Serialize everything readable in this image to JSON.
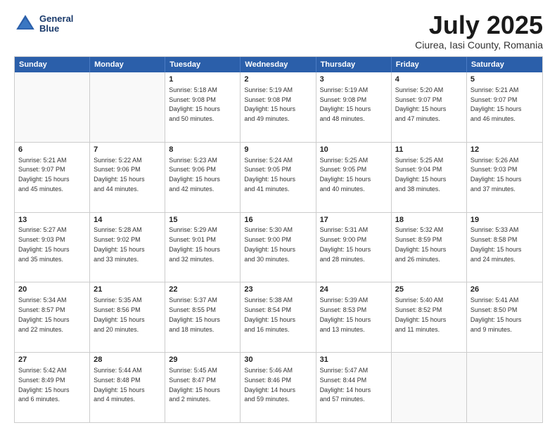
{
  "logo": {
    "line1": "General",
    "line2": "Blue"
  },
  "title": "July 2025",
  "location": "Ciurea, Iasi County, Romania",
  "header_days": [
    "Sunday",
    "Monday",
    "Tuesday",
    "Wednesday",
    "Thursday",
    "Friday",
    "Saturday"
  ],
  "weeks": [
    [
      {
        "day": "",
        "info": ""
      },
      {
        "day": "",
        "info": ""
      },
      {
        "day": "1",
        "info": "Sunrise: 5:18 AM\nSunset: 9:08 PM\nDaylight: 15 hours\nand 50 minutes."
      },
      {
        "day": "2",
        "info": "Sunrise: 5:19 AM\nSunset: 9:08 PM\nDaylight: 15 hours\nand 49 minutes."
      },
      {
        "day": "3",
        "info": "Sunrise: 5:19 AM\nSunset: 9:08 PM\nDaylight: 15 hours\nand 48 minutes."
      },
      {
        "day": "4",
        "info": "Sunrise: 5:20 AM\nSunset: 9:07 PM\nDaylight: 15 hours\nand 47 minutes."
      },
      {
        "day": "5",
        "info": "Sunrise: 5:21 AM\nSunset: 9:07 PM\nDaylight: 15 hours\nand 46 minutes."
      }
    ],
    [
      {
        "day": "6",
        "info": "Sunrise: 5:21 AM\nSunset: 9:07 PM\nDaylight: 15 hours\nand 45 minutes."
      },
      {
        "day": "7",
        "info": "Sunrise: 5:22 AM\nSunset: 9:06 PM\nDaylight: 15 hours\nand 44 minutes."
      },
      {
        "day": "8",
        "info": "Sunrise: 5:23 AM\nSunset: 9:06 PM\nDaylight: 15 hours\nand 42 minutes."
      },
      {
        "day": "9",
        "info": "Sunrise: 5:24 AM\nSunset: 9:05 PM\nDaylight: 15 hours\nand 41 minutes."
      },
      {
        "day": "10",
        "info": "Sunrise: 5:25 AM\nSunset: 9:05 PM\nDaylight: 15 hours\nand 40 minutes."
      },
      {
        "day": "11",
        "info": "Sunrise: 5:25 AM\nSunset: 9:04 PM\nDaylight: 15 hours\nand 38 minutes."
      },
      {
        "day": "12",
        "info": "Sunrise: 5:26 AM\nSunset: 9:03 PM\nDaylight: 15 hours\nand 37 minutes."
      }
    ],
    [
      {
        "day": "13",
        "info": "Sunrise: 5:27 AM\nSunset: 9:03 PM\nDaylight: 15 hours\nand 35 minutes."
      },
      {
        "day": "14",
        "info": "Sunrise: 5:28 AM\nSunset: 9:02 PM\nDaylight: 15 hours\nand 33 minutes."
      },
      {
        "day": "15",
        "info": "Sunrise: 5:29 AM\nSunset: 9:01 PM\nDaylight: 15 hours\nand 32 minutes."
      },
      {
        "day": "16",
        "info": "Sunrise: 5:30 AM\nSunset: 9:00 PM\nDaylight: 15 hours\nand 30 minutes."
      },
      {
        "day": "17",
        "info": "Sunrise: 5:31 AM\nSunset: 9:00 PM\nDaylight: 15 hours\nand 28 minutes."
      },
      {
        "day": "18",
        "info": "Sunrise: 5:32 AM\nSunset: 8:59 PM\nDaylight: 15 hours\nand 26 minutes."
      },
      {
        "day": "19",
        "info": "Sunrise: 5:33 AM\nSunset: 8:58 PM\nDaylight: 15 hours\nand 24 minutes."
      }
    ],
    [
      {
        "day": "20",
        "info": "Sunrise: 5:34 AM\nSunset: 8:57 PM\nDaylight: 15 hours\nand 22 minutes."
      },
      {
        "day": "21",
        "info": "Sunrise: 5:35 AM\nSunset: 8:56 PM\nDaylight: 15 hours\nand 20 minutes."
      },
      {
        "day": "22",
        "info": "Sunrise: 5:37 AM\nSunset: 8:55 PM\nDaylight: 15 hours\nand 18 minutes."
      },
      {
        "day": "23",
        "info": "Sunrise: 5:38 AM\nSunset: 8:54 PM\nDaylight: 15 hours\nand 16 minutes."
      },
      {
        "day": "24",
        "info": "Sunrise: 5:39 AM\nSunset: 8:53 PM\nDaylight: 15 hours\nand 13 minutes."
      },
      {
        "day": "25",
        "info": "Sunrise: 5:40 AM\nSunset: 8:52 PM\nDaylight: 15 hours\nand 11 minutes."
      },
      {
        "day": "26",
        "info": "Sunrise: 5:41 AM\nSunset: 8:50 PM\nDaylight: 15 hours\nand 9 minutes."
      }
    ],
    [
      {
        "day": "27",
        "info": "Sunrise: 5:42 AM\nSunset: 8:49 PM\nDaylight: 15 hours\nand 6 minutes."
      },
      {
        "day": "28",
        "info": "Sunrise: 5:44 AM\nSunset: 8:48 PM\nDaylight: 15 hours\nand 4 minutes."
      },
      {
        "day": "29",
        "info": "Sunrise: 5:45 AM\nSunset: 8:47 PM\nDaylight: 15 hours\nand 2 minutes."
      },
      {
        "day": "30",
        "info": "Sunrise: 5:46 AM\nSunset: 8:46 PM\nDaylight: 14 hours\nand 59 minutes."
      },
      {
        "day": "31",
        "info": "Sunrise: 5:47 AM\nSunset: 8:44 PM\nDaylight: 14 hours\nand 57 minutes."
      },
      {
        "day": "",
        "info": ""
      },
      {
        "day": "",
        "info": ""
      }
    ]
  ]
}
